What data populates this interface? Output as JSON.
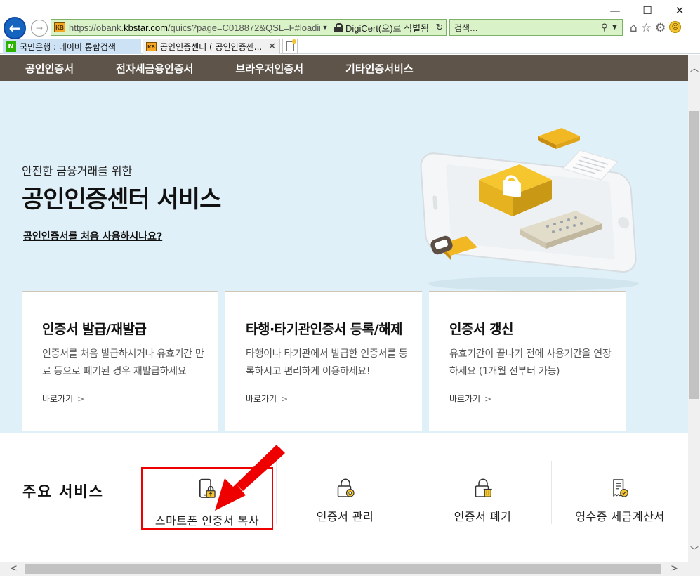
{
  "window": {
    "minimize": "—",
    "maximize": "☐",
    "close": "✕"
  },
  "address_bar": {
    "url_prefix": "https://obank.",
    "url_domain": "kbstar.com",
    "url_path": "/quics?page=C018872&QSL=F#loading",
    "cert_label": "DigiCert(으)로 식별됨",
    "site_icon_text": "KB"
  },
  "search": {
    "placeholder": "검색..."
  },
  "tabs": [
    {
      "label": "국민은행 : 네이버 통합검색",
      "favicon": "N"
    },
    {
      "label": "공인인증센터 ( 공인인증센...",
      "favicon": "KB"
    }
  ],
  "nav": {
    "items": [
      "공인인증서",
      "전자세금용인증서",
      "브라우저인증서",
      "기타인증서비스"
    ]
  },
  "hero": {
    "subtitle": "안전한 금융거래를 위한",
    "title": "공인인증센터 서비스",
    "link": "공인인증서를 처음 사용하시나요?"
  },
  "cards": [
    {
      "title": "인증서 발급/재발급",
      "desc": "인증서를 처음 발급하시거나 유효기간 만료 등으로 폐기된 경우 재발급하세요",
      "link": "바로가기"
    },
    {
      "title": "타행·타기관인증서 등록/해제",
      "desc": "타행이나 타기관에서 발급한 인증서를 등록하시고 편리하게 이용하세요!",
      "link": "바로가기"
    },
    {
      "title": "인증서 갱신",
      "desc": "유효기간이 끝나기 전에 사용기간을 연장하세요 (1개월 전부터 가능)",
      "link": "바로가기"
    }
  ],
  "services": {
    "heading": "주요 서비스",
    "items": [
      {
        "label": "스마트폰 인증서 복사",
        "icon": "smartphone-lock-icon"
      },
      {
        "label": "인증서 관리",
        "icon": "lock-gear-icon"
      },
      {
        "label": "인증서 폐기",
        "icon": "lock-trash-icon"
      },
      {
        "label": "영수증 세금계산서",
        "icon": "receipt-check-icon"
      }
    ]
  },
  "colors": {
    "nav_bg": "#5e544a",
    "hero_bg": "#dff0f8",
    "accent_yellow": "#f6c62e",
    "highlight_red": "#ee0000",
    "address_bg": "#d9f2c7"
  }
}
